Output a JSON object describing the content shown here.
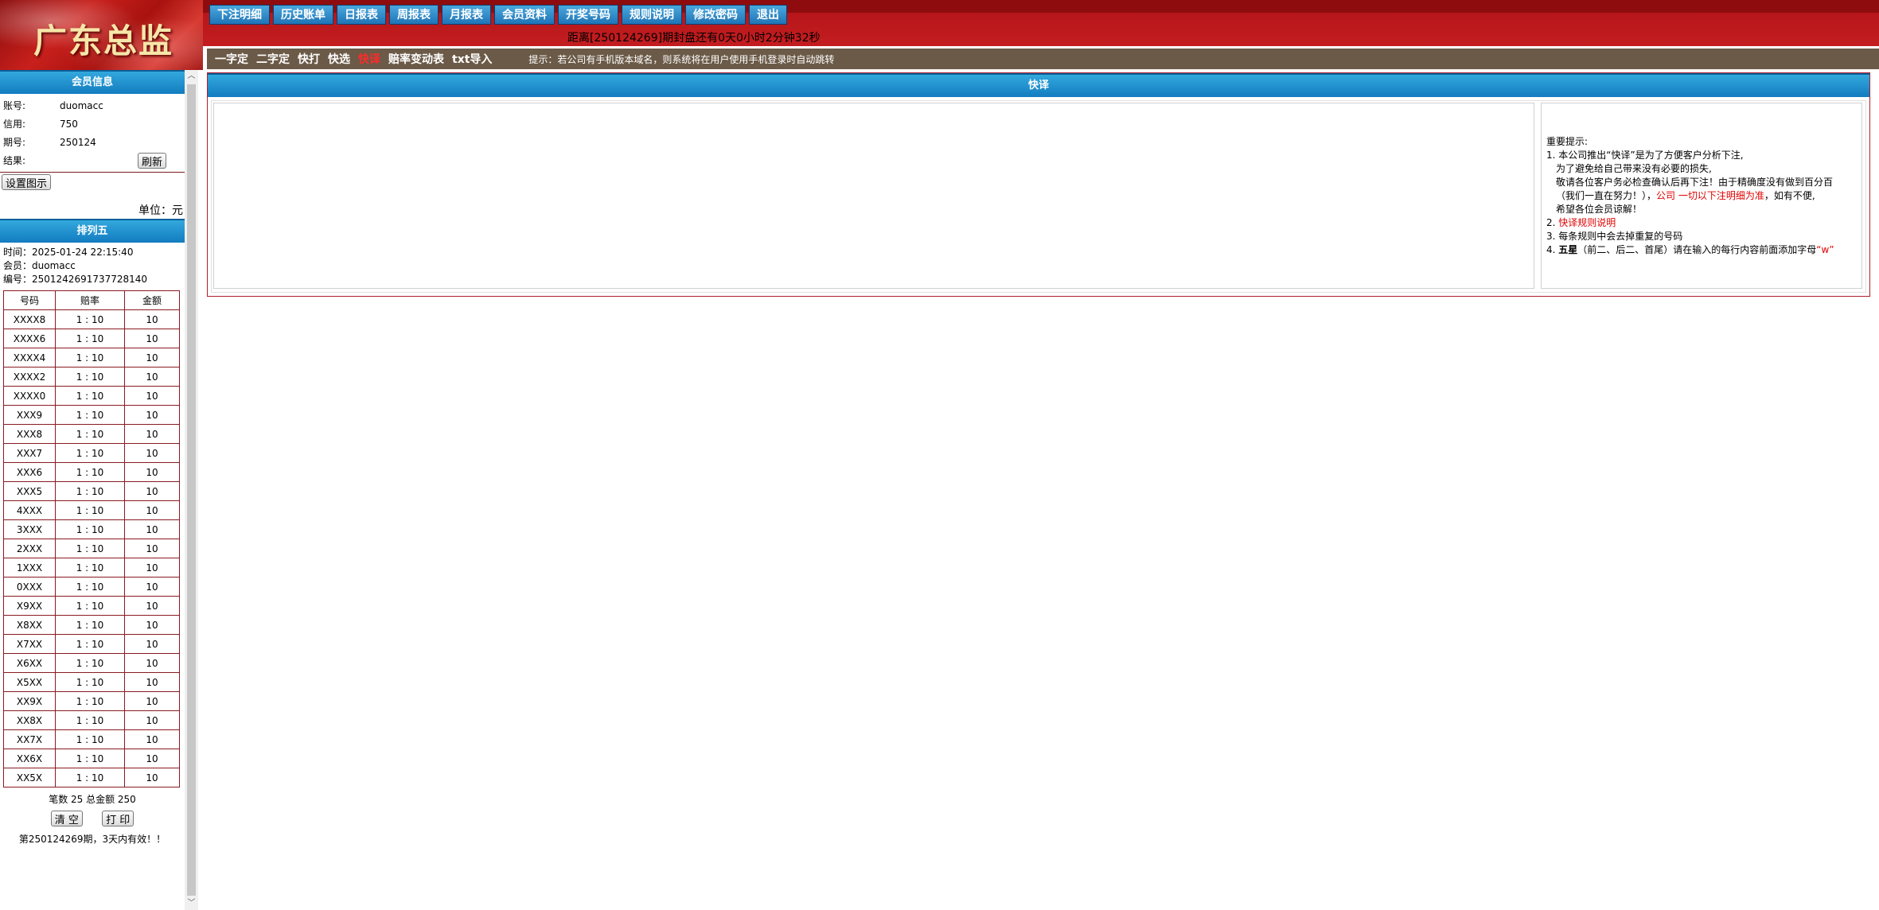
{
  "brand": {
    "title": "广东总监"
  },
  "nav": [
    "下注明细",
    "历史账单",
    "日报表",
    "周报表",
    "月报表",
    "会员资料",
    "开奖号码",
    "规则说明",
    "修改密码",
    "退出"
  ],
  "countdown": "距离[250124269]期封盘还有0天0小时2分钟32秒",
  "subnav": {
    "items": [
      "一字定",
      "二字定",
      "快打",
      "快选",
      "快译",
      "赔率变动表",
      "txt导入"
    ],
    "active_index": 4,
    "hint": "提示：若公司有手机版本域名，则系统将在用户使用手机登录时自动跳转"
  },
  "member": {
    "header": "会员信息",
    "account_label": "账号:",
    "account": "duomacc",
    "credit_label": "信用:",
    "credit": "750",
    "period_label": "期号:",
    "period": "250124",
    "result_label": "结果:",
    "refresh_button": "刷新",
    "settings_button": "设置图示",
    "unit": "单位：元"
  },
  "ticket": {
    "header": "排列五",
    "time": "时间：2025-01-24 22:15:40",
    "member": "会员：duomacc",
    "serial": "编号：2501242691737728140",
    "columns": [
      "号码",
      "赔率",
      "金额"
    ],
    "rows": [
      [
        "XXXX8",
        "1 : 10",
        "10"
      ],
      [
        "XXXX6",
        "1 : 10",
        "10"
      ],
      [
        "XXXX4",
        "1 : 10",
        "10"
      ],
      [
        "XXXX2",
        "1 : 10",
        "10"
      ],
      [
        "XXXX0",
        "1 : 10",
        "10"
      ],
      [
        "XXX9",
        "1 : 10",
        "10"
      ],
      [
        "XXX8",
        "1 : 10",
        "10"
      ],
      [
        "XXX7",
        "1 : 10",
        "10"
      ],
      [
        "XXX6",
        "1 : 10",
        "10"
      ],
      [
        "XXX5",
        "1 : 10",
        "10"
      ],
      [
        "4XXX",
        "1 : 10",
        "10"
      ],
      [
        "3XXX",
        "1 : 10",
        "10"
      ],
      [
        "2XXX",
        "1 : 10",
        "10"
      ],
      [
        "1XXX",
        "1 : 10",
        "10"
      ],
      [
        "0XXX",
        "1 : 10",
        "10"
      ],
      [
        "X9XX",
        "1 : 10",
        "10"
      ],
      [
        "X8XX",
        "1 : 10",
        "10"
      ],
      [
        "X7XX",
        "1 : 10",
        "10"
      ],
      [
        "X6XX",
        "1 : 10",
        "10"
      ],
      [
        "X5XX",
        "1 : 10",
        "10"
      ],
      [
        "XX9X",
        "1 : 10",
        "10"
      ],
      [
        "XX8X",
        "1 : 10",
        "10"
      ],
      [
        "XX7X",
        "1 : 10",
        "10"
      ],
      [
        "XX6X",
        "1 : 10",
        "10"
      ],
      [
        "XX5X",
        "1 : 10",
        "10"
      ]
    ],
    "summary": "笔数 25 总金额 250",
    "clear_button": "清 空",
    "print_button": "打 印",
    "validity": "第250124269期，3天内有效！！"
  },
  "main": {
    "header": "快译",
    "input_value": "",
    "notes": {
      "title": "重要提示:",
      "l1": "1. 本公司推出“快译”是为了方便客户分析下注,",
      "l1b": "为了避免给自己带来没有必要的损失,",
      "l1c": "敬请各位客户务必检查确认后再下注！由于精确度没有做到百分百",
      "l1d_a": "（我们一直在努力！），",
      "l1d_b": "公司 一切以下注明细为准",
      "l1d_c": "，如有不便,",
      "l1e": "希望各位会员谅解！",
      "l2_prefix": "2. ",
      "l2_link": "快译规则说明",
      "l3": "3. 每条规则中会去掉重复的号码",
      "l4_prefix": "4. ",
      "l4_bold": "五星",
      "l4_text": "（前二、后二、首尾）请在输入的每行内容前面添加字母",
      "l4_letter": "“w”"
    }
  },
  "colors": {
    "brand_red": "#c41d20",
    "nav_blue": "#1f74b6",
    "subbar_brown": "#6b5a47",
    "border_red": "#8a1a22"
  }
}
